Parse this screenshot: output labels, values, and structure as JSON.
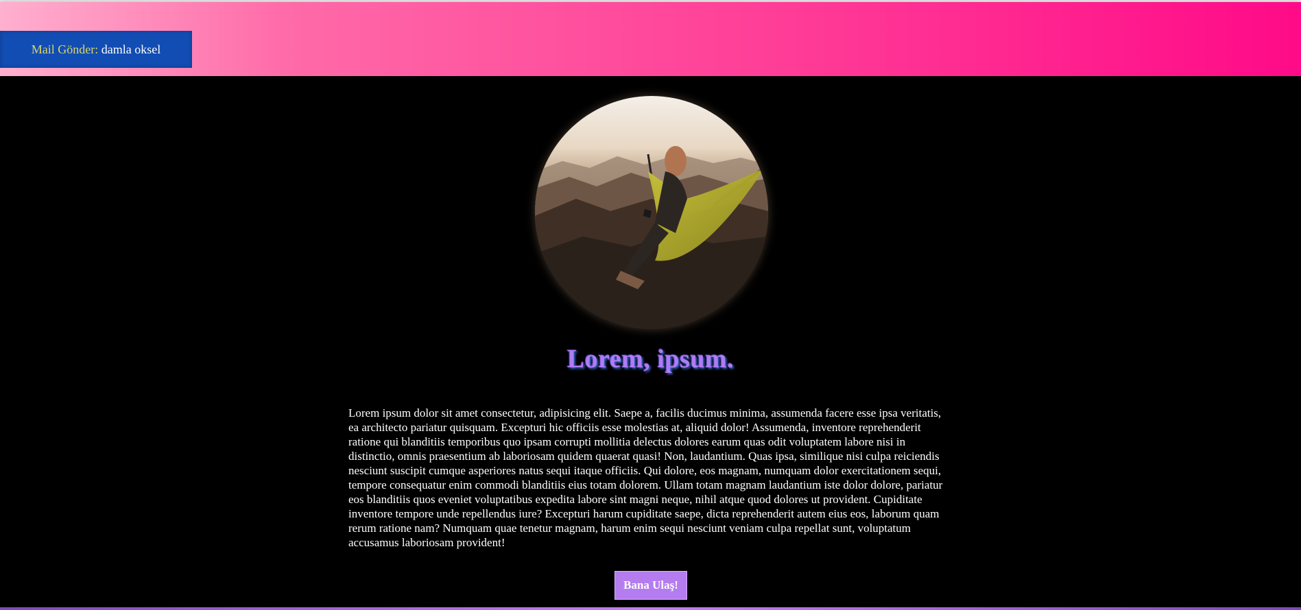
{
  "header": {
    "mail_label": "Mail Gönder:",
    "mail_name": " damla oksel"
  },
  "profile": {
    "image_icon": "hammock-mountain-photo"
  },
  "main": {
    "title": "Lorem, ipsum.",
    "paragraph": "Lorem ipsum dolor sit amet consectetur, adipisicing elit. Saepe a, facilis ducimus minima, assumenda facere esse ipsa veritatis, ea architecto pariatur quisquam. Excepturi hic officiis esse molestias at, aliquid dolor! Assumenda, inventore reprehenderit ratione qui blanditiis temporibus quo ipsam corrupti mollitia delectus dolores earum quas odit voluptatem labore nisi in distinctio, omnis praesentium ab laboriosam quidem quaerat quasi! Non, laudantium. Quas ipsa, similique nisi culpa reiciendis nesciunt suscipit cumque asperiores natus sequi itaque officiis. Qui dolore, eos magnam, numquam dolor exercitationem sequi, tempore consequatur enim commodi blanditiis eius totam dolorem. Ullam totam magnam laudantium iste dolor dolore, pariatur eos blanditiis quos eveniet voluptatibus expedita labore sint magni neque, nihil atque quod dolores ut provident. Cupiditate inventore tempore unde repellendus iure? Excepturi harum cupiditate saepe, dicta reprehenderit autem eius eos, laborum quam rerum ratione nam? Numquam quae tenetur magnam, harum enim sequi nesciunt veniam culpa repellat sunt, voluptatum accusamus laboriosam provident!",
    "button_label": "Bana Ulaş!"
  },
  "colors": {
    "header_gradient_start": "#ffb0cf",
    "header_gradient_end": "#ff0a88",
    "mail_box": "#124db3",
    "mail_label": "#d8d66a",
    "title": "#b07bf5",
    "button": "#b57cf0",
    "background": "#000000"
  }
}
